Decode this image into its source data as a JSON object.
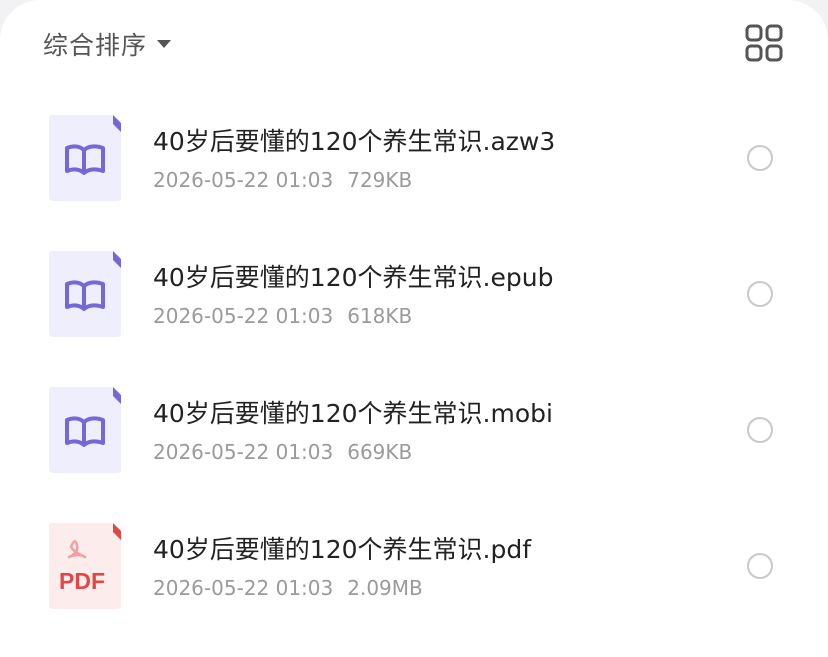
{
  "toolbar": {
    "sort_label": "综合排序",
    "sort_icon": "caret-down-icon",
    "view_icon": "grid-view-icon"
  },
  "colors": {
    "ebook_icon_bg": "#efeefc",
    "ebook_icon_accent": "#7468d8",
    "pdf_icon_bg": "#fdecec",
    "pdf_icon_accent": "#e04848",
    "text_primary": "#222222",
    "text_secondary": "#9a9a9a"
  },
  "files": [
    {
      "name": "40岁后要懂的120个养生常识.azw3",
      "date": "2026-05-22 01:03",
      "size": "729KB",
      "icon": "book-icon"
    },
    {
      "name": "40岁后要懂的120个养生常识.epub",
      "date": "2026-05-22 01:03",
      "size": "618KB",
      "icon": "book-icon"
    },
    {
      "name": "40岁后要懂的120个养生常识.mobi",
      "date": "2026-05-22 01:03",
      "size": "669KB",
      "icon": "book-icon"
    },
    {
      "name": "40岁后要懂的120个养生常识.pdf",
      "date": "2026-05-22 01:03",
      "size": "2.09MB",
      "icon": "pdf-icon",
      "icon_label": "PDF"
    }
  ]
}
